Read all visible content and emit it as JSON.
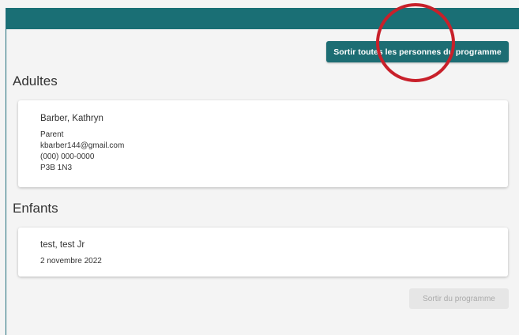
{
  "toolbar": {
    "remove_all_label": "Sortir toutes les personnes du programme"
  },
  "adults": {
    "title": "Adultes",
    "people": [
      {
        "name": "Barber, Kathryn",
        "role": "Parent",
        "email": "kbarber144@gmail.com",
        "phone": "(000) 000-0000",
        "postal_code": "P3B 1N3"
      }
    ]
  },
  "children": {
    "title": "Enfants",
    "people": [
      {
        "name": "test, test Jr",
        "birthdate": "2 novembre 2022"
      }
    ]
  },
  "footer": {
    "remove_label": "Sortir du programme"
  },
  "colors": {
    "header": "#1a6f75",
    "primary_button": "#1d6d73",
    "annotation": "#c8202a"
  }
}
